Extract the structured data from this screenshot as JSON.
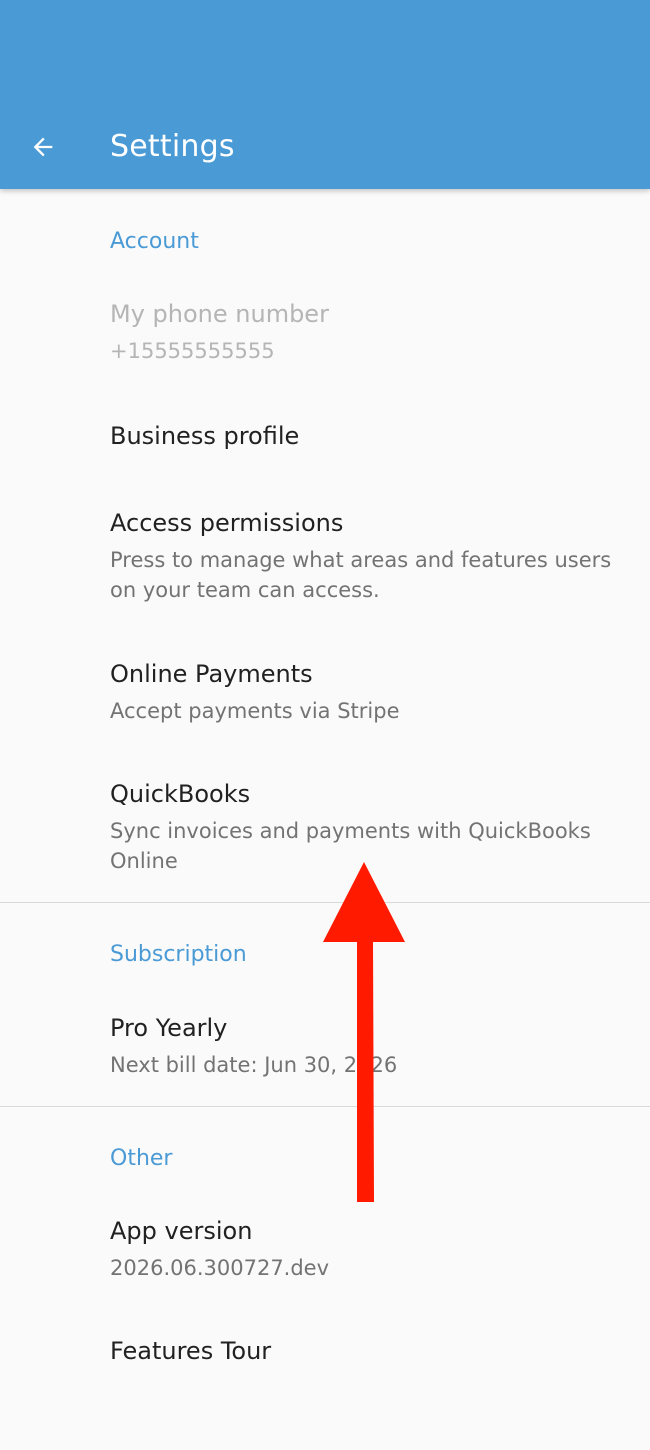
{
  "appbar": {
    "title": "Settings",
    "back_icon": "arrow-back-icon",
    "color": "#4a9ad6"
  },
  "sections": {
    "account": {
      "header": "Account",
      "phone": {
        "title": "My phone number",
        "summary": "+15555555555",
        "enabled": false
      },
      "business_profile": {
        "title": "Business profile"
      },
      "access_permissions": {
        "title": "Access permissions",
        "summary": "Press to manage what areas and features users on your team can access."
      },
      "online_payments": {
        "title": "Online Payments",
        "summary": "Accept payments via Stripe"
      },
      "quickbooks": {
        "title": "QuickBooks",
        "summary": "Sync invoices and payments with QuickBooks Online"
      }
    },
    "subscription": {
      "header": "Subscription",
      "plan": {
        "title": "Pro Yearly",
        "summary": "Next bill date: Jun 30, 2026"
      }
    },
    "other": {
      "header": "Other",
      "app_version": {
        "title": "App version",
        "summary": "2026.06.300727.dev"
      },
      "features_tour": {
        "title": "Features Tour"
      }
    }
  },
  "overlay": {
    "annotation": "red-arrow-up",
    "color": "#ff1a00"
  }
}
